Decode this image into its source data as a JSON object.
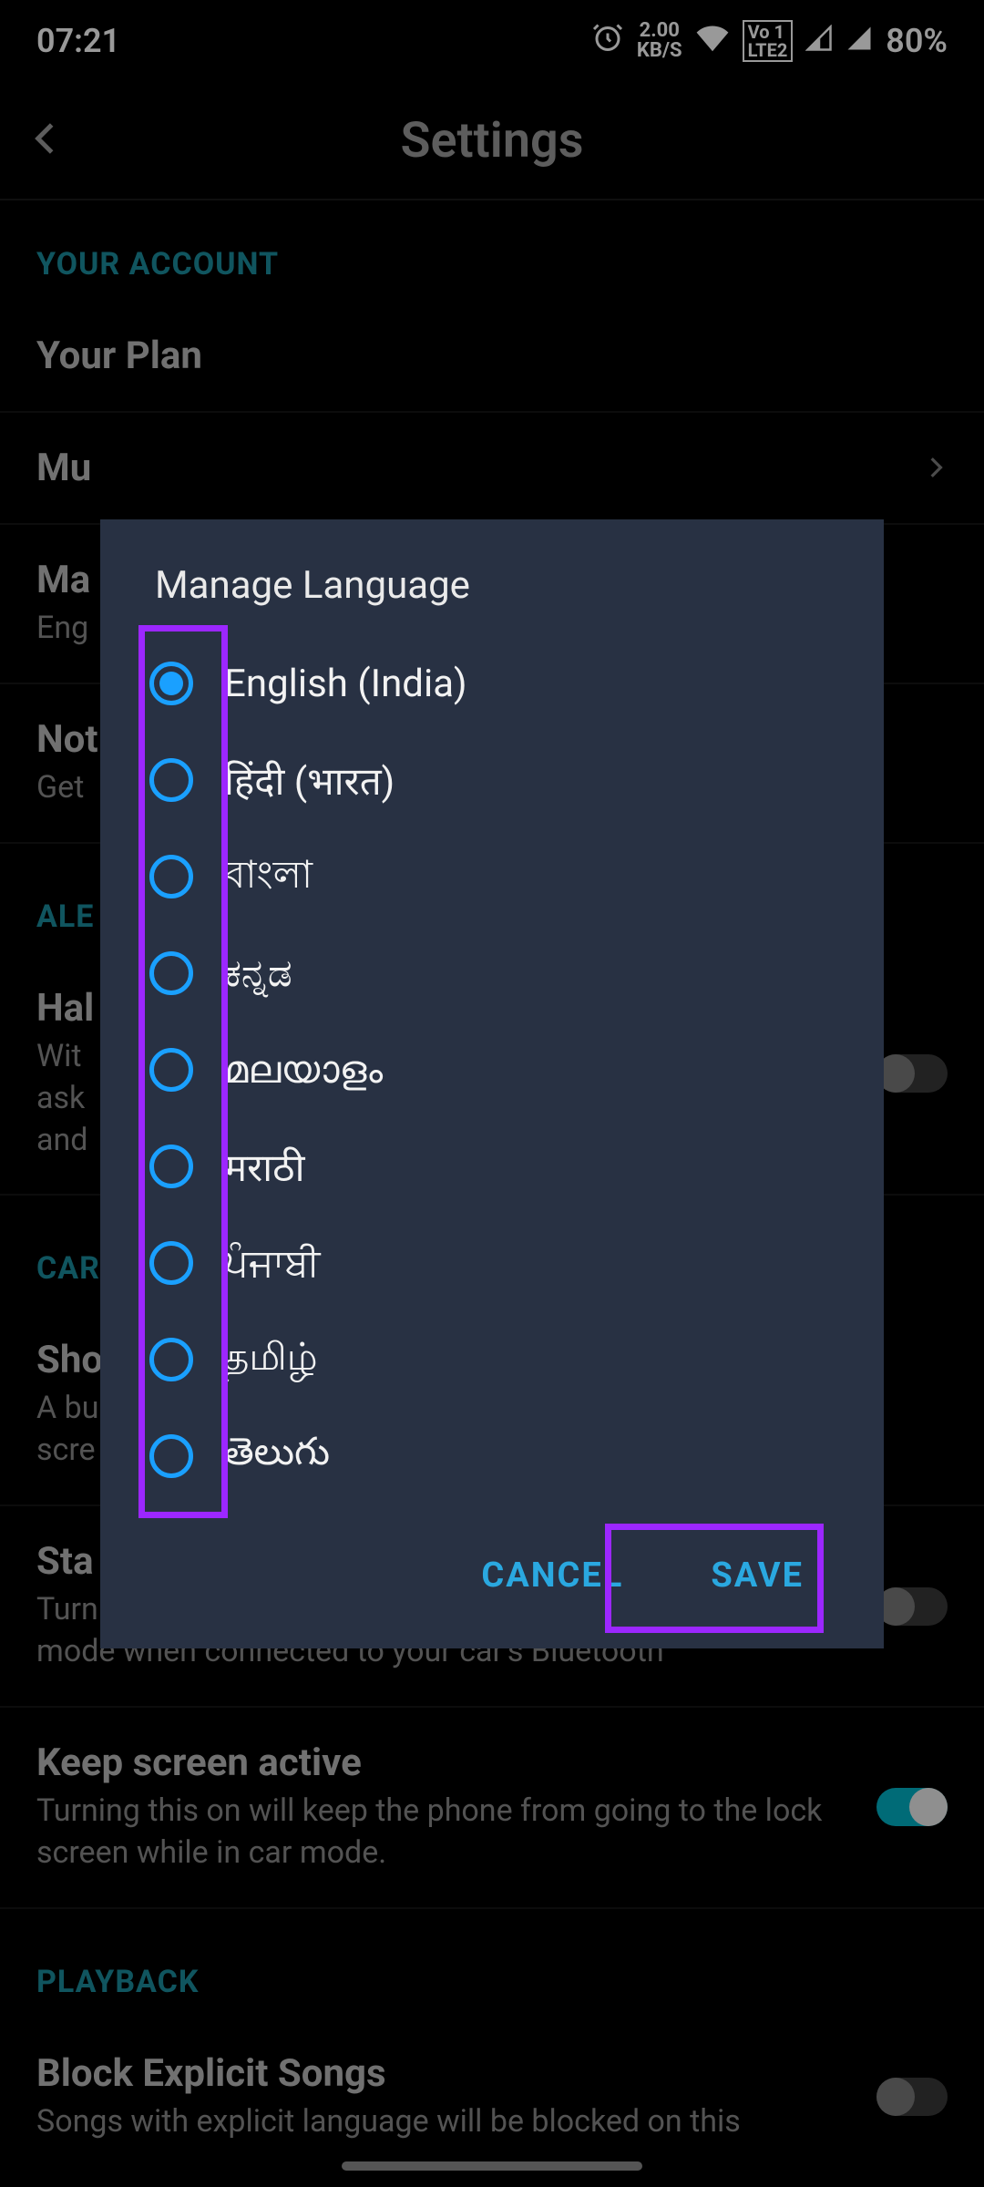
{
  "status": {
    "time": "07:21",
    "net_speed_top": "2.00",
    "net_speed_bot": "KB/S",
    "lte_label": "Vo1\nLTE2",
    "battery": "80%"
  },
  "header": {
    "title": "Settings"
  },
  "sections": {
    "account_label": "YOUR ACCOUNT",
    "your_plan": "Your Plan",
    "music_quality": "Mu",
    "manage_language_title": "Ma",
    "manage_language_sub": "Eng",
    "notifications_title": "Not",
    "notifications_sub": "Get",
    "alexa_label": "ALE",
    "handsfree_title": "Hal",
    "handsfree_sub": "Wit\nask\nand",
    "car_label": "CAR",
    "show_title": "Sho",
    "show_sub": "A bu\nscre",
    "start_title": "Sta",
    "start_sub": "Turn this on and the app will automatically go into car mode when connected to your car's Bluetooth",
    "keep_title": "Keep screen active",
    "keep_sub": "Turning this on will keep the phone from going to the lock screen while in car mode.",
    "playback_label": "PLAYBACK",
    "block_title": "Block Explicit Songs",
    "block_sub": "Songs with explicit language will be blocked on this"
  },
  "dialog": {
    "title": "Manage Language",
    "languages": [
      {
        "label": "English (India)",
        "selected": true
      },
      {
        "label": "हिंदी (भारत)",
        "selected": false
      },
      {
        "label": "বাংলা",
        "selected": false
      },
      {
        "label": "ಕನ್ನಡ",
        "selected": false
      },
      {
        "label": "മലയാളം",
        "selected": false
      },
      {
        "label": "मराठी",
        "selected": false
      },
      {
        "label": "ਪੰਜਾਬੀ",
        "selected": false
      },
      {
        "label": "தமிழ்",
        "selected": false
      },
      {
        "label": "తెలుగు",
        "selected": false
      }
    ],
    "cancel": "CANCEL",
    "save": "SAVE"
  }
}
